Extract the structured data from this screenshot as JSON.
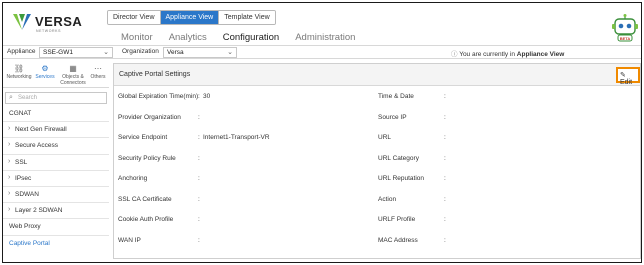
{
  "brand": {
    "name": "VERSA",
    "sub": "NETWORKS"
  },
  "view_tabs": [
    "Director View",
    "Appliance View",
    "Template View"
  ],
  "nav": [
    "Monitor",
    "Analytics",
    "Configuration",
    "Administration"
  ],
  "robot_label": "BETA",
  "context": {
    "appliance_label": "Appliance",
    "appliance_value": "SSE-GW1",
    "organization_label": "Organization",
    "organization_value": "Versa",
    "info_prefix": "You are currently in",
    "info_view": "Appliance View"
  },
  "sidebar": {
    "tabs": [
      "Networking",
      "Services",
      "Objects & Connectors",
      "Others"
    ],
    "search_placeholder": "Search",
    "items": [
      {
        "label": "CGNAT",
        "expandable": false
      },
      {
        "label": "Next Gen Firewall",
        "expandable": true
      },
      {
        "label": "Secure Access",
        "expandable": true
      },
      {
        "label": "SSL",
        "expandable": true
      },
      {
        "label": "IPsec",
        "expandable": true
      },
      {
        "label": "SDWAN",
        "expandable": true
      },
      {
        "label": "Layer 2 SDWAN",
        "expandable": true
      },
      {
        "label": "Web Proxy",
        "expandable": false
      },
      {
        "label": "Captive Portal",
        "expandable": false,
        "selected": true
      }
    ]
  },
  "panel": {
    "title": "Captive Portal Settings",
    "edit_label": "Edit",
    "left_fields": [
      {
        "label": "Global Expiration Time(min)",
        "value": "30"
      },
      {
        "label": "Provider Organization",
        "value": ""
      },
      {
        "label": "Service Endpoint",
        "value": "Internet1-Transport-VR"
      },
      {
        "label": "Security Policy Rule",
        "value": ""
      },
      {
        "label": "Anchoring",
        "value": ""
      },
      {
        "label": "SSL CA Certificate",
        "value": ""
      },
      {
        "label": "Cookie Auth Profile",
        "value": ""
      },
      {
        "label": "WAN IP",
        "value": ""
      }
    ],
    "right_fields": [
      {
        "label": "Time & Date",
        "value": ""
      },
      {
        "label": "Source IP",
        "value": ""
      },
      {
        "label": "URL",
        "value": ""
      },
      {
        "label": "URL Category",
        "value": ""
      },
      {
        "label": "URL Reputation",
        "value": ""
      },
      {
        "label": "Action",
        "value": ""
      },
      {
        "label": "URLF Profile",
        "value": ""
      },
      {
        "label": "MAC Address",
        "value": ""
      }
    ]
  },
  "colors": {
    "accent": "#2b77c9",
    "highlight": "#f08a00"
  }
}
